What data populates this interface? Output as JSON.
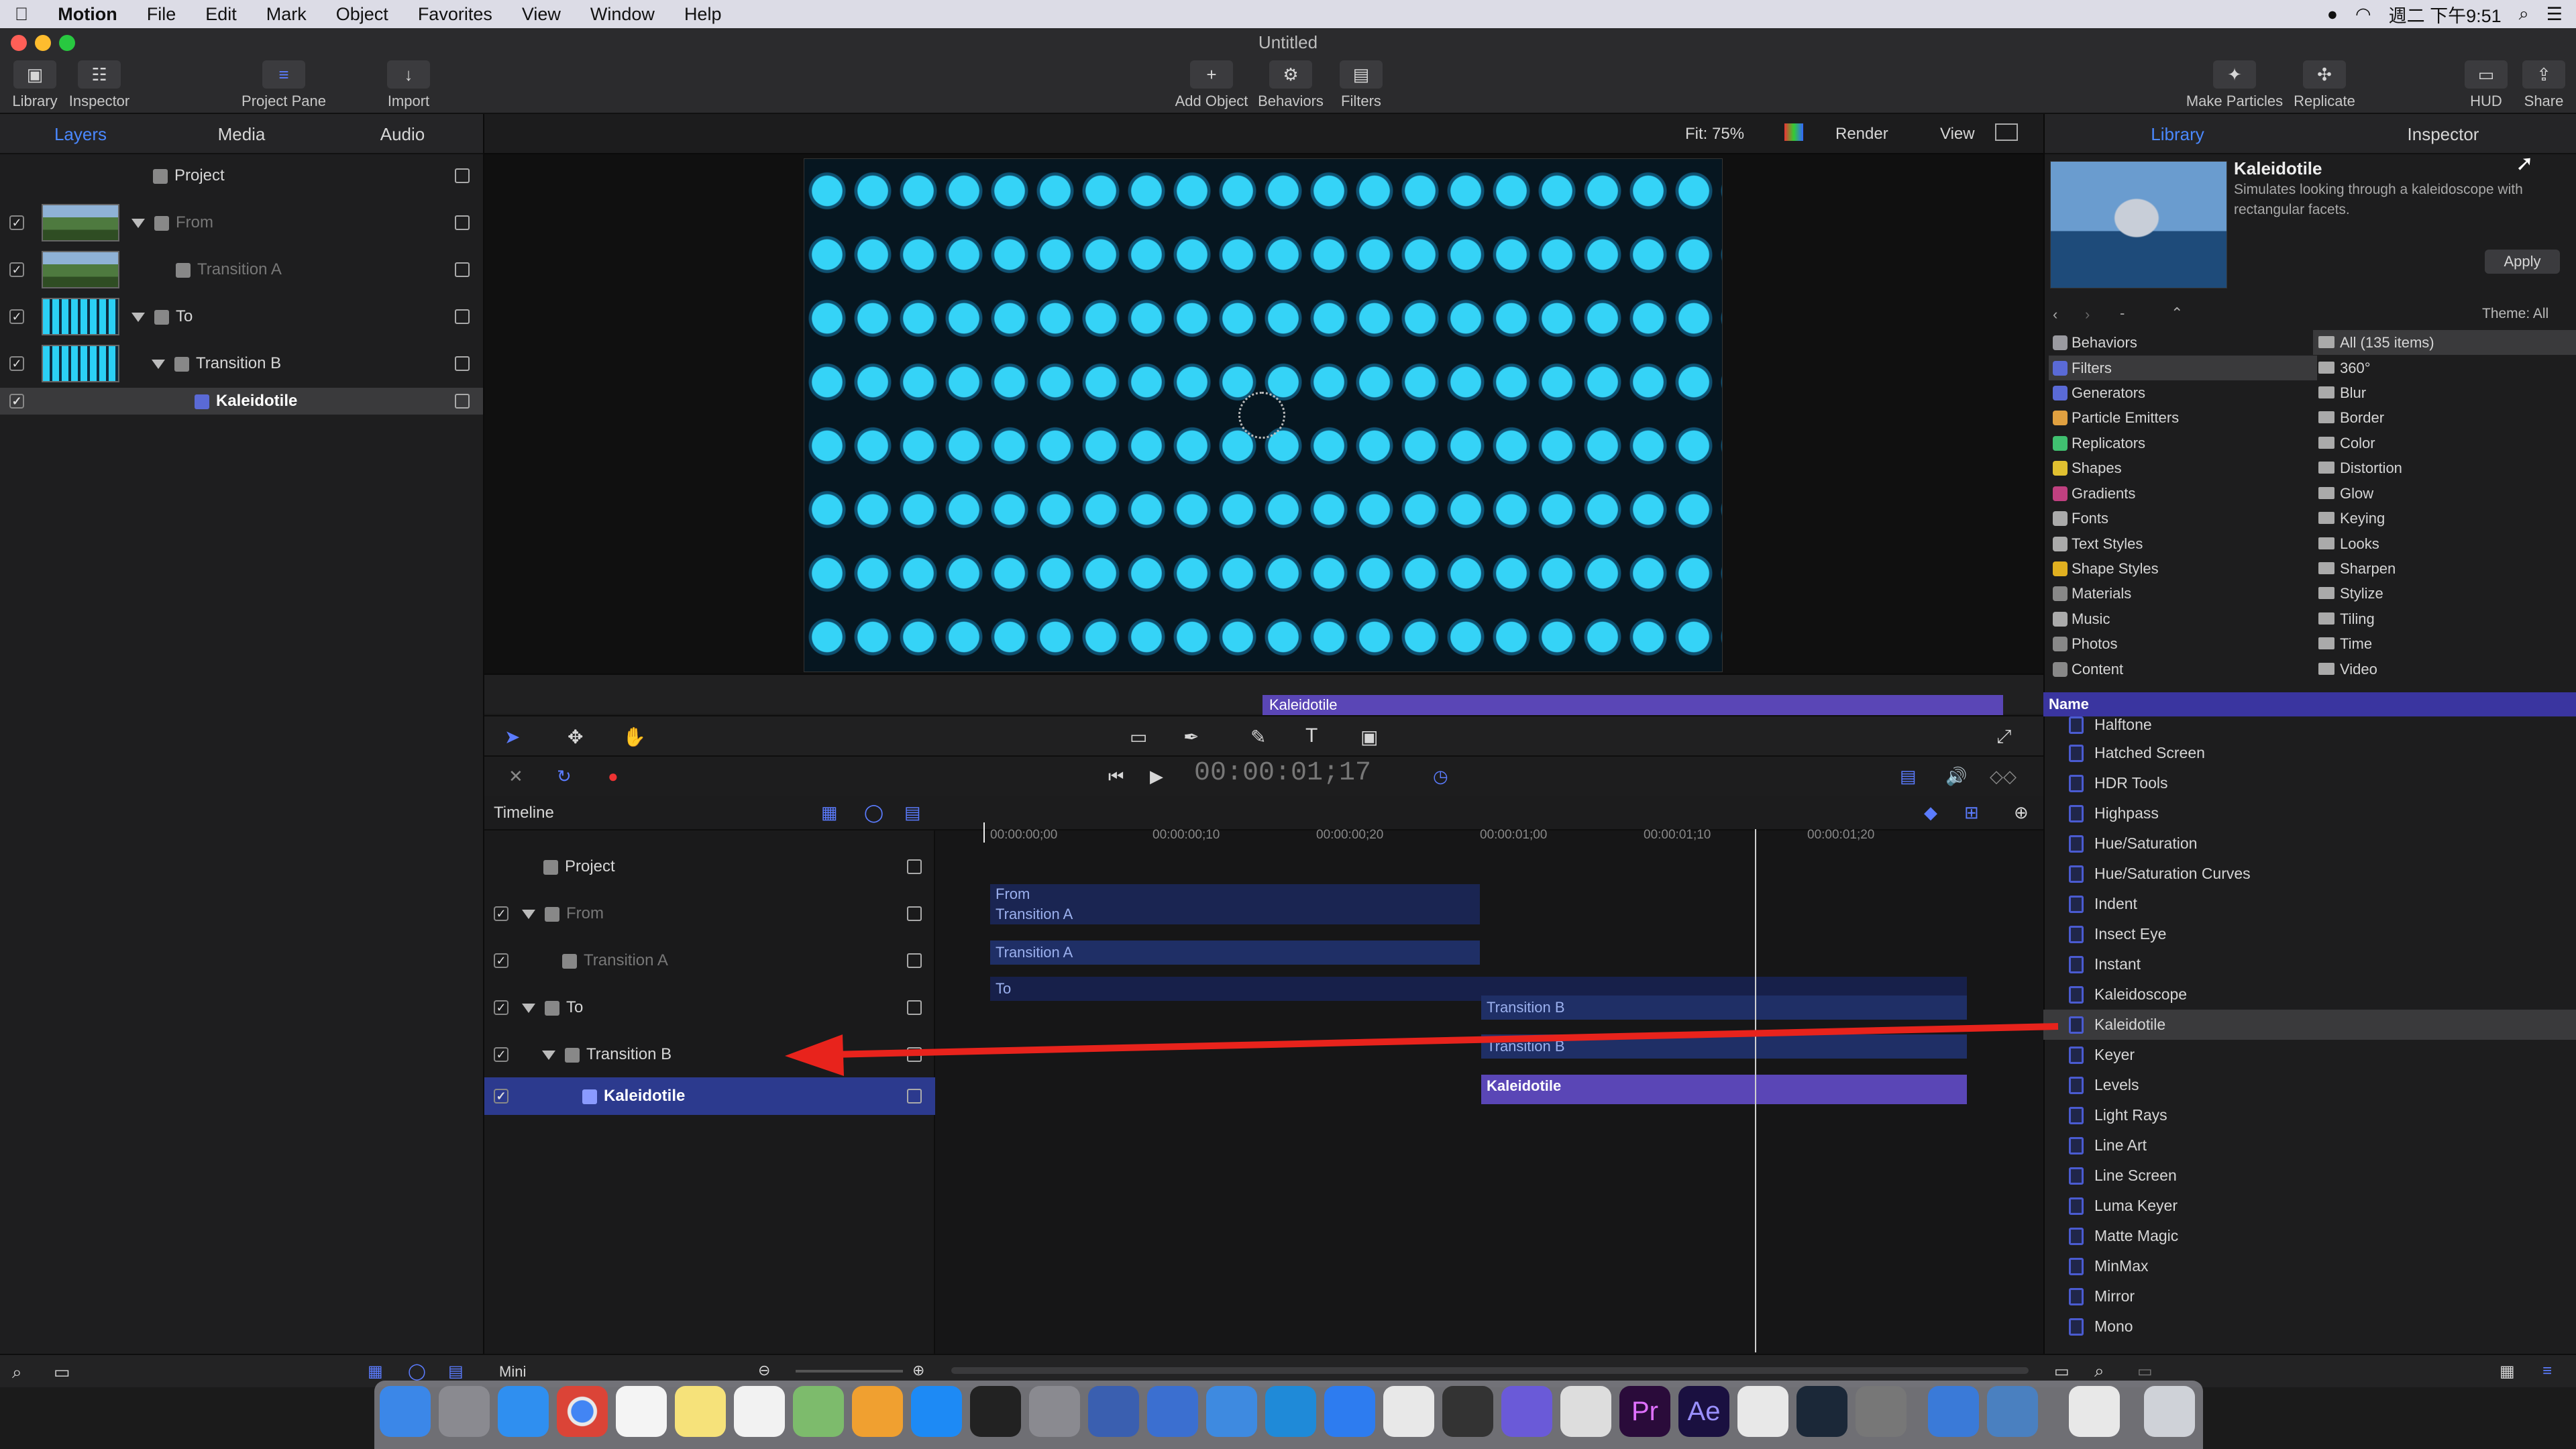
{
  "menubar": {
    "app": "Motion",
    "items": [
      "File",
      "Edit",
      "Mark",
      "Object",
      "Favorites",
      "View",
      "Window",
      "Help"
    ],
    "clock": "週二 下午9:51"
  },
  "window": {
    "title": "Untitled"
  },
  "toolbar": {
    "library": "Library",
    "inspector": "Inspector",
    "project_pane": "Project Pane",
    "import": "Import",
    "add_object": "Add Object",
    "behaviors": "Behaviors",
    "filters": "Filters",
    "make_particles": "Make Particles",
    "replicate": "Replicate",
    "hud": "HUD",
    "share": "Share"
  },
  "left_tabs": [
    "Layers",
    "Media",
    "Audio"
  ],
  "layers": [
    {
      "name": "Project"
    },
    {
      "name": "From"
    },
    {
      "name": "Transition A"
    },
    {
      "name": "To"
    },
    {
      "name": "Transition B"
    },
    {
      "name": "Kaleidotile"
    }
  ],
  "canvas_header": {
    "fit": "Fit: 75%",
    "render": "Render",
    "view": "View"
  },
  "mini_timeline": {
    "clip": "Kaleidotile"
  },
  "transport": {
    "timecode": "00:00:01;17"
  },
  "timeline": {
    "title": "Timeline",
    "rows": [
      "Project",
      "From",
      "Transition A",
      "To",
      "Transition B",
      "Kaleidotile"
    ],
    "ruler": [
      "00:00:00;00",
      "00:00:00;10",
      "00:00:00;20",
      "00:00:01;00",
      "00:00:01;10",
      "00:00:01;20"
    ],
    "clips": {
      "from": "From",
      "from_transition": "Transition A",
      "transition_a": "Transition A",
      "to": "To",
      "to_transition": "Transition B",
      "transition_b": "Transition B",
      "kaleidotile": "Kaleidotile"
    }
  },
  "bottom_bar": {
    "mode": "Mini"
  },
  "right_tabs": [
    "Library",
    "Inspector"
  ],
  "preview": {
    "name": "Kaleidotile",
    "description": "Simulates looking through a kaleidoscope with rectangular facets.",
    "apply": "Apply",
    "theme": "Theme: All"
  },
  "categories": [
    {
      "label": "Behaviors",
      "color": "#9a9aa0"
    },
    {
      "label": "Filters",
      "color": "#5a6ad6"
    },
    {
      "label": "Generators",
      "color": "#5a6ad6"
    },
    {
      "label": "Particle Emitters",
      "color": "#e0a040"
    },
    {
      "label": "Replicators",
      "color": "#40c070"
    },
    {
      "label": "Shapes",
      "color": "#e0c030"
    },
    {
      "label": "Gradients",
      "color": "#c04080"
    },
    {
      "label": "Fonts",
      "color": "#aaaaaa"
    },
    {
      "label": "Text Styles",
      "color": "#aaaaaa"
    },
    {
      "label": "Shape Styles",
      "color": "#e0b020"
    },
    {
      "label": "Materials",
      "color": "#888888"
    },
    {
      "label": "Music",
      "color": "#aaaaaa"
    },
    {
      "label": "Photos",
      "color": "#888888"
    },
    {
      "label": "Content",
      "color": "#888888"
    }
  ],
  "subcategories": [
    "All (135 items)",
    "360°",
    "Blur",
    "Border",
    "Color",
    "Distortion",
    "Glow",
    "Keying",
    "Looks",
    "Sharpen",
    "Stylize",
    "Tiling",
    "Time",
    "Video"
  ],
  "list": {
    "header": "Name",
    "items": [
      "Halftone",
      "Hatched Screen",
      "HDR Tools",
      "Highpass",
      "Hue/Saturation",
      "Hue/Saturation Curves",
      "Indent",
      "Insect Eye",
      "Instant",
      "Kaleidoscope",
      "Kaleidotile",
      "Keyer",
      "Levels",
      "Light Rays",
      "Line Art",
      "Line Screen",
      "Luma Keyer",
      "Matte Magic",
      "MinMax",
      "Mirror",
      "Mono"
    ]
  },
  "colors": {
    "accent": "#4a88ff",
    "selection": "#5a46b6",
    "arrow": "#e8231c"
  }
}
